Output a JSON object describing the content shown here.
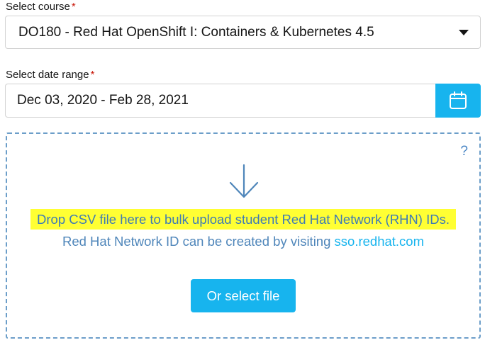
{
  "course": {
    "label": "Select course",
    "required_mark": "*",
    "selected": "DO180 - Red Hat OpenShift I: Containers & Kubernetes 4.5"
  },
  "date_range": {
    "label": "Select date range",
    "required_mark": "*",
    "value": "Dec 03, 2020 - Feb 28, 2021",
    "calendar_icon": "calendar-icon"
  },
  "dropzone": {
    "help": "?",
    "arrow_icon": "arrow-down-icon",
    "instruction": "Drop CSV file here to bulk upload student Red Hat Network (RHN) IDs.",
    "sub_prefix": "Red Hat Network ID can be created by visiting ",
    "sub_link": "sso.redhat.com",
    "button_label": "Or select file"
  },
  "colors": {
    "accent": "#17b4ee",
    "dashed_border": "#6c9ec9",
    "highlight": "#ffff33",
    "required": "#c9190b"
  }
}
